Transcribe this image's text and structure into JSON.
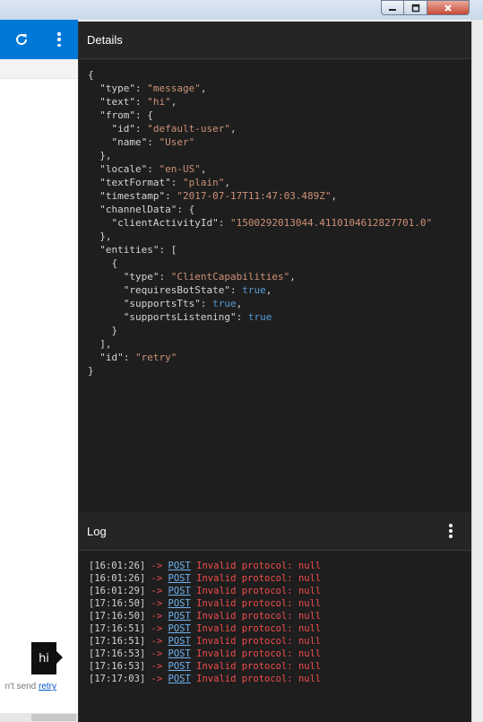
{
  "left": {
    "chat_message": "hi",
    "status_text": "n't send",
    "retry_label": "retry"
  },
  "details": {
    "title": "Details",
    "json_lines": [
      [
        {
          "t": "p",
          "v": "{"
        }
      ],
      [
        {
          "t": "p",
          "v": "  "
        },
        {
          "t": "k",
          "v": "\"type\""
        },
        {
          "t": "p",
          "v": ": "
        },
        {
          "t": "s",
          "v": "\"message\""
        },
        {
          "t": "p",
          "v": ","
        }
      ],
      [
        {
          "t": "p",
          "v": "  "
        },
        {
          "t": "k",
          "v": "\"text\""
        },
        {
          "t": "p",
          "v": ": "
        },
        {
          "t": "s",
          "v": "\"hi\""
        },
        {
          "t": "p",
          "v": ","
        }
      ],
      [
        {
          "t": "p",
          "v": "  "
        },
        {
          "t": "k",
          "v": "\"from\""
        },
        {
          "t": "p",
          "v": ": {"
        }
      ],
      [
        {
          "t": "p",
          "v": "    "
        },
        {
          "t": "k",
          "v": "\"id\""
        },
        {
          "t": "p",
          "v": ": "
        },
        {
          "t": "s",
          "v": "\"default-user\""
        },
        {
          "t": "p",
          "v": ","
        }
      ],
      [
        {
          "t": "p",
          "v": "    "
        },
        {
          "t": "k",
          "v": "\"name\""
        },
        {
          "t": "p",
          "v": ": "
        },
        {
          "t": "s",
          "v": "\"User\""
        }
      ],
      [
        {
          "t": "p",
          "v": "  },"
        }
      ],
      [
        {
          "t": "p",
          "v": "  "
        },
        {
          "t": "k",
          "v": "\"locale\""
        },
        {
          "t": "p",
          "v": ": "
        },
        {
          "t": "s",
          "v": "\"en-US\""
        },
        {
          "t": "p",
          "v": ","
        }
      ],
      [
        {
          "t": "p",
          "v": "  "
        },
        {
          "t": "k",
          "v": "\"textFormat\""
        },
        {
          "t": "p",
          "v": ": "
        },
        {
          "t": "s",
          "v": "\"plain\""
        },
        {
          "t": "p",
          "v": ","
        }
      ],
      [
        {
          "t": "p",
          "v": "  "
        },
        {
          "t": "k",
          "v": "\"timestamp\""
        },
        {
          "t": "p",
          "v": ": "
        },
        {
          "t": "s",
          "v": "\"2017-07-17T11:47:03.489Z\""
        },
        {
          "t": "p",
          "v": ","
        }
      ],
      [
        {
          "t": "p",
          "v": "  "
        },
        {
          "t": "k",
          "v": "\"channelData\""
        },
        {
          "t": "p",
          "v": ": {"
        }
      ],
      [
        {
          "t": "p",
          "v": "    "
        },
        {
          "t": "k",
          "v": "\"clientActivityId\""
        },
        {
          "t": "p",
          "v": ": "
        },
        {
          "t": "s",
          "v": "\"1500292013044.4110104612827701.0\""
        }
      ],
      [
        {
          "t": "p",
          "v": "  },"
        }
      ],
      [
        {
          "t": "p",
          "v": "  "
        },
        {
          "t": "k",
          "v": "\"entities\""
        },
        {
          "t": "p",
          "v": ": ["
        }
      ],
      [
        {
          "t": "p",
          "v": "    {"
        }
      ],
      [
        {
          "t": "p",
          "v": "      "
        },
        {
          "t": "k",
          "v": "\"type\""
        },
        {
          "t": "p",
          "v": ": "
        },
        {
          "t": "s",
          "v": "\"ClientCapabilities\""
        },
        {
          "t": "p",
          "v": ","
        }
      ],
      [
        {
          "t": "p",
          "v": "      "
        },
        {
          "t": "k",
          "v": "\"requiresBotState\""
        },
        {
          "t": "p",
          "v": ": "
        },
        {
          "t": "b",
          "v": "true"
        },
        {
          "t": "p",
          "v": ","
        }
      ],
      [
        {
          "t": "p",
          "v": "      "
        },
        {
          "t": "k",
          "v": "\"supportsTts\""
        },
        {
          "t": "p",
          "v": ": "
        },
        {
          "t": "b",
          "v": "true"
        },
        {
          "t": "p",
          "v": ","
        }
      ],
      [
        {
          "t": "p",
          "v": "      "
        },
        {
          "t": "k",
          "v": "\"supportsListening\""
        },
        {
          "t": "p",
          "v": ": "
        },
        {
          "t": "b",
          "v": "true"
        }
      ],
      [
        {
          "t": "p",
          "v": "    }"
        }
      ],
      [
        {
          "t": "p",
          "v": "  ],"
        }
      ],
      [
        {
          "t": "p",
          "v": "  "
        },
        {
          "t": "k",
          "v": "\"id\""
        },
        {
          "t": "p",
          "v": ": "
        },
        {
          "t": "s",
          "v": "\"retry\""
        }
      ],
      [
        {
          "t": "p",
          "v": "}"
        }
      ]
    ]
  },
  "log": {
    "title": "Log",
    "arrow": "->",
    "method": "POST",
    "message": "Invalid protocol: null",
    "entries": [
      "[16:01:26]",
      "[16:01:26]",
      "[16:01:29]",
      "[17:16:50]",
      "[17:16:50]",
      "[17:16:51]",
      "[17:16:51]",
      "[17:16:53]",
      "[17:16:53]",
      "[17:17:03]"
    ]
  },
  "icons": {
    "refresh": "refresh-icon",
    "left_menu": "more-vertical-icon",
    "log_menu": "more-vertical-icon",
    "minimize": "minimize-icon",
    "maximize": "maximize-icon",
    "close": "close-icon"
  },
  "colors": {
    "accent": "#0078d7",
    "panel_bg": "#1e1e1e",
    "string": "#ce9178",
    "boolean": "#569cd6",
    "error": "#f14c4c",
    "link": "#6fb3f2"
  }
}
